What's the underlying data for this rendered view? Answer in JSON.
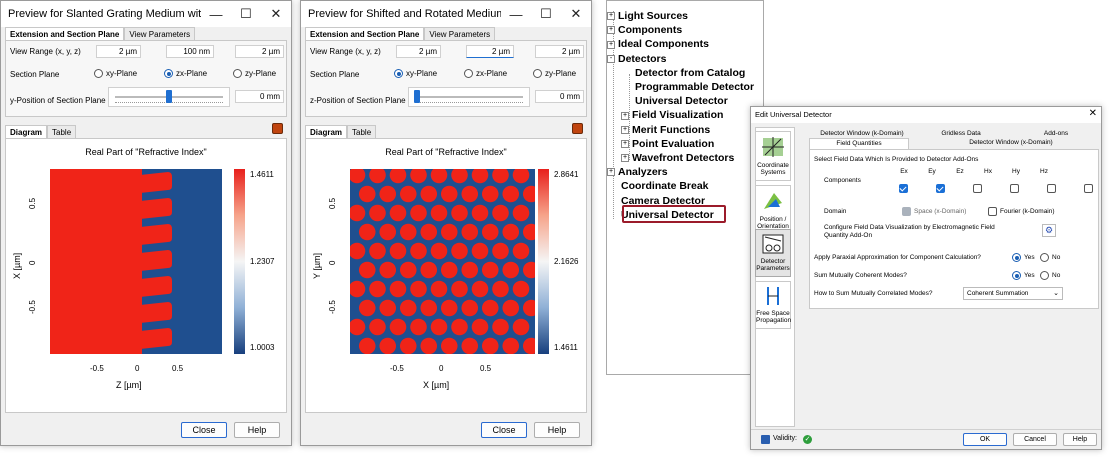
{
  "win1": {
    "title": "Preview for Slanted Grating Medium with Rounded Edg...",
    "tabs": [
      "Extension and Section Plane",
      "View Parameters"
    ],
    "view_range_label": "View Range (x, y, z)",
    "view_range": [
      "2 µm",
      "100 nm",
      "2 µm"
    ],
    "section_plane_label": "Section Plane",
    "planes": [
      "xy-Plane",
      "zx-Plane",
      "zy-Plane"
    ],
    "selected_plane": 1,
    "position_label": "y-Position of Section Plane",
    "position_value": "0 mm",
    "slider_fraction": 0.5,
    "diagram_tabs": [
      "Diagram",
      "Table"
    ],
    "plot_title": "Real Part of \"Refractive Index\"",
    "y_axis_label": "X [µm]",
    "x_axis_label": "Z [µm]",
    "y_ticks": [
      "0.5",
      "0",
      "-0.5"
    ],
    "x_ticks": [
      "-0.5",
      "0",
      "0.5"
    ],
    "colorbar": [
      "1.4611",
      "1.2307",
      "1.0003"
    ],
    "close": "Close",
    "help": "Help"
  },
  "win2": {
    "title": "Preview for Shifted and Rotated Medium",
    "tabs": [
      "Extension and Section Plane",
      "View Parameters"
    ],
    "view_range_label": "View Range (x, y, z)",
    "view_range": [
      "2 µm",
      "2 µm",
      "2 µm"
    ],
    "section_plane_label": "Section Plane",
    "planes": [
      "xy-Plane",
      "zx-Plane",
      "zy-Plane"
    ],
    "selected_plane": 0,
    "position_label": "z-Position of Section Plane",
    "position_value": "0 mm",
    "slider_fraction": 0.0,
    "diagram_tabs": [
      "Diagram",
      "Table"
    ],
    "plot_title": "Real Part of \"Refractive Index\"",
    "y_axis_label": "Y [µm]",
    "x_axis_label": "X [µm]",
    "y_ticks": [
      "0.5",
      "0",
      "-0.5"
    ],
    "x_ticks": [
      "-0.5",
      "0",
      "0.5"
    ],
    "colorbar": [
      "2.8641",
      "2.1626",
      "1.4611"
    ],
    "close": "Close",
    "help": "Help"
  },
  "tree": {
    "items": [
      {
        "label": "Light Sources",
        "level": 0,
        "exp": "+"
      },
      {
        "label": "Components",
        "level": 0,
        "exp": "+"
      },
      {
        "label": "Ideal Components",
        "level": 0,
        "exp": "+"
      },
      {
        "label": "Detectors",
        "level": 0,
        "exp": "-"
      },
      {
        "label": "Detector from Catalog",
        "level": 1,
        "exp": ""
      },
      {
        "label": "Programmable Detector",
        "level": 1,
        "exp": ""
      },
      {
        "label": "Universal Detector",
        "level": 1,
        "exp": ""
      },
      {
        "label": "Field Visualization",
        "level": 1,
        "exp": "+"
      },
      {
        "label": "Merit Functions",
        "level": 1,
        "exp": "+"
      },
      {
        "label": "Point Evaluation",
        "level": 1,
        "exp": "+"
      },
      {
        "label": "Wavefront Detectors",
        "level": 1,
        "exp": "+"
      },
      {
        "label": "Analyzers",
        "level": 0,
        "exp": "+"
      },
      {
        "label": "Coordinate Break",
        "level": 0,
        "exp": ""
      },
      {
        "label": "Camera Detector",
        "level": 0,
        "exp": ""
      },
      {
        "label": "Universal Detector",
        "level": 0,
        "exp": "",
        "highlight": true
      }
    ]
  },
  "dlg": {
    "title": "Edit Universal Detector",
    "side": [
      "Coordinate Systems",
      "Position / Orientation",
      "Detector Parameters",
      "Free Space Propagation"
    ],
    "tabs_top": [
      "Detector Window (k-Domain)",
      "Gridless Data",
      "Add-ons"
    ],
    "tabs_bottom": [
      "Field Quantities",
      "Detector Window (x-Domain)"
    ],
    "section_label": "Select Field Data Which Is Provided to Detector Add-Ons",
    "components_label": "Components",
    "components": [
      {
        "name": "Ex",
        "checked": true
      },
      {
        "name": "Ey",
        "checked": true
      },
      {
        "name": "Ez",
        "checked": false
      },
      {
        "name": "Hx",
        "checked": false
      },
      {
        "name": "Hy",
        "checked": false
      },
      {
        "name": "Hz",
        "checked": false
      }
    ],
    "domain_label": "Domain",
    "domain_space": "Space (x-Domain)",
    "domain_fourier": "Fourier (k-Domain)",
    "configure_label": "Configure Field Data Visualization by Electromagnetic Field Quantity Add-On",
    "q1": "Apply Paraxial Approximation for Component Calculation?",
    "q2": "Sum Mutually Coherent Modes?",
    "yes": "Yes",
    "no": "No",
    "q3": "How to Sum Mutually Correlated Modes?",
    "q3_value": "Coherent Summation",
    "validity": "Validity:",
    "ok": "OK",
    "cancel": "Cancel",
    "help": "Help"
  }
}
